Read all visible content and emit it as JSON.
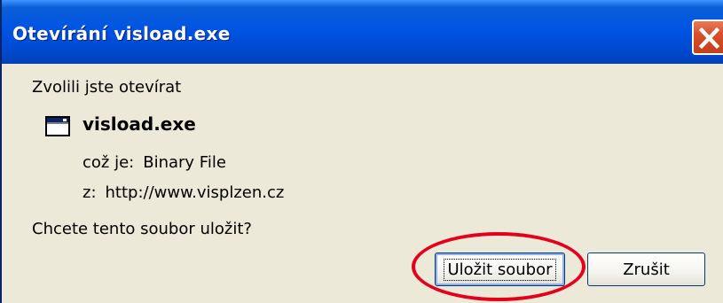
{
  "dialog": {
    "title": "Otevírání visload.exe",
    "prompt": "Zvolili jste otevírat",
    "file": {
      "icon": "application-window-icon",
      "name": "visload.exe",
      "type_label": "což je:",
      "type_value": "Binary File",
      "from_label": "z:",
      "from_value": "http://www.visplzen.cz"
    },
    "question": "Chcete tento soubor uložit?",
    "buttons": {
      "save_label": "Uložit soubor",
      "cancel_label": "Zrušit"
    }
  },
  "colors": {
    "titlebar": "#0054e3",
    "dialog_background": "#ece9d8",
    "close_button": "#d8512a",
    "highlight": "#e5001b"
  }
}
